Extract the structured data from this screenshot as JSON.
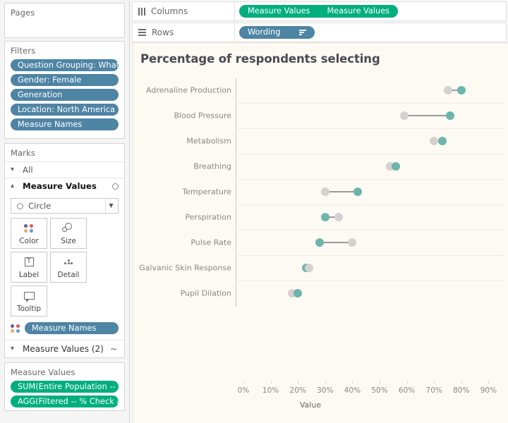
{
  "left_panel": {
    "pages": {
      "title": "Pages"
    },
    "filters": {
      "title": "Filters",
      "items": [
        {
          "label": "Question Grouping: What do..",
          "icon": "filter-pill"
        },
        {
          "label": "Gender: Female",
          "icon": "filter-pill"
        },
        {
          "label": "Generation",
          "icon": "filter-pill"
        },
        {
          "label": "Location: North America",
          "icon": "filter-pill"
        },
        {
          "label": "Measure Names",
          "icon": "filter-pill"
        }
      ]
    },
    "marks": {
      "title": "Marks",
      "all_label": "All",
      "measure_values_label": "Measure Values",
      "mark_type": "Circle",
      "buttons": [
        {
          "label": "Color",
          "icon": "color-dots-icon"
        },
        {
          "label": "Size",
          "icon": "size-circles-icon"
        },
        {
          "label": "Label",
          "icon": "label-text-icon"
        },
        {
          "label": "Detail",
          "icon": "detail-dots-icon"
        },
        {
          "label": "Tooltip",
          "icon": "tooltip-bubble-icon"
        }
      ],
      "encoding_pill": "Measure Names",
      "measure_values_2_label": "Measure Values (2)"
    },
    "legend": {
      "title": "Measure Values",
      "items": [
        {
          "label": "SUM(Entire Population -- % .."
        },
        {
          "label": "AGG(Filtered -- % Check all .."
        }
      ]
    }
  },
  "shelves": {
    "columns": {
      "label": "Columns",
      "icon": "columns-icon",
      "pills": [
        {
          "label": "Measure Values"
        },
        {
          "label": "Measure Values"
        }
      ]
    },
    "rows": {
      "label": "Rows",
      "icon": "rows-icon",
      "pills": [
        {
          "label": "Wording",
          "sort": true
        }
      ]
    }
  },
  "colors": {
    "pill_blue": "#4e84a4",
    "pill_green": "#00ae7e",
    "dot_gray": "#d4d2d0",
    "dot_teal": "#6cb5ab",
    "viz_background": "#fdfaf4",
    "title_text": "#4a4a52",
    "axis_text": "#8b8680"
  },
  "chart_data": {
    "type": "scatter",
    "title": "Percentage of respondents selecting",
    "xlabel": "Value",
    "ylabel": "",
    "xlim": [
      0,
      0.95
    ],
    "xticks": [
      "0%",
      "10%",
      "20%",
      "30%",
      "40%",
      "50%",
      "60%",
      "70%",
      "80%",
      "90%"
    ],
    "xtick_values": [
      0,
      10,
      20,
      30,
      40,
      50,
      60,
      70,
      80,
      90
    ],
    "grid": true,
    "legend_position": "left-panel",
    "categories": [
      "Adrenaline Production",
      "Blood Pressure",
      "Metabolism",
      "Breathing",
      "Temperature",
      "Perspiration",
      "Pulse Rate",
      "Galvanic Skin Response",
      "Pupil Dilation"
    ],
    "series": [
      {
        "name": "SUM(Entire Population -- % ..",
        "color": "#d4d2d0",
        "values": [
          75,
          59,
          70,
          54,
          30,
          35,
          40,
          24,
          18
        ]
      },
      {
        "name": "AGG(Filtered -- % Check all ..",
        "color": "#6cb5ab",
        "values": [
          80,
          76,
          73,
          56,
          42,
          30,
          28,
          23,
          20
        ]
      }
    ]
  }
}
